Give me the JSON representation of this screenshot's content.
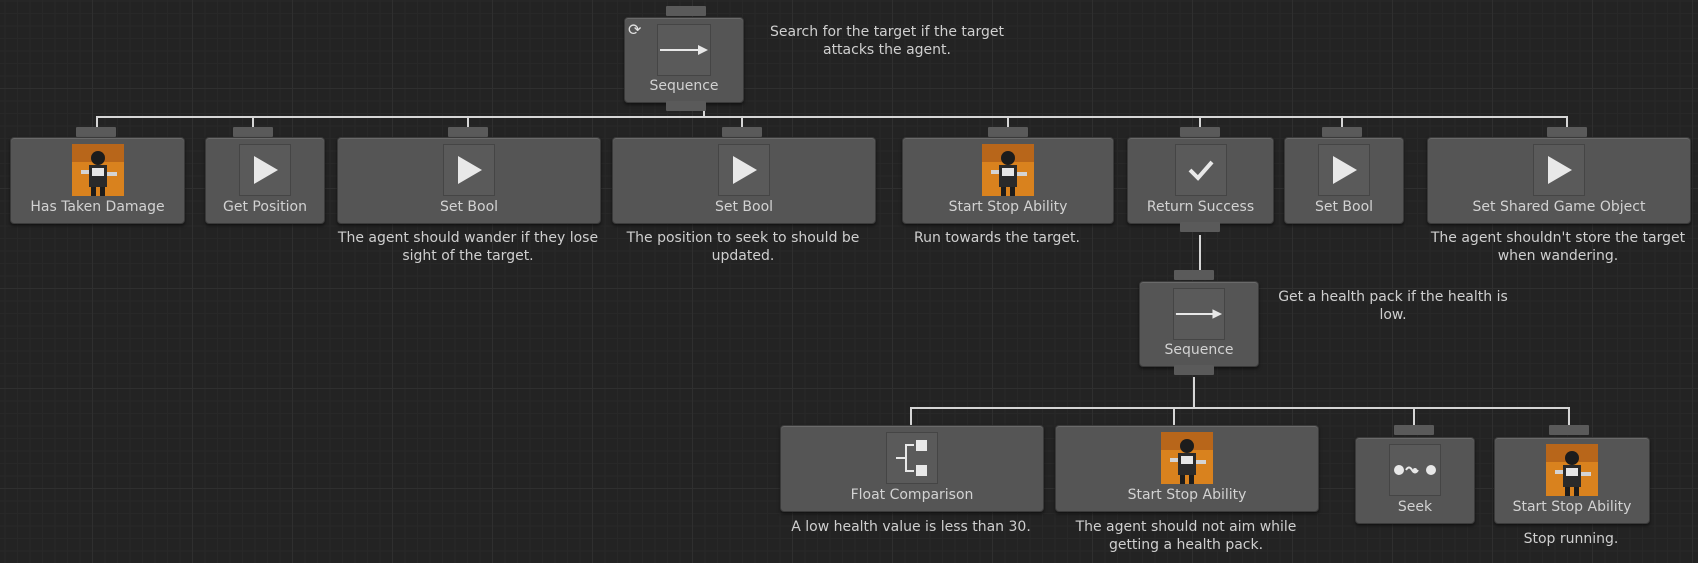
{
  "root": {
    "label": "Sequence",
    "comment": "Search for the target if the target attacks the agent.",
    "icon": "sequence-arrow-icon",
    "conditional_abort_icon": "restart-icon"
  },
  "level1": [
    {
      "label": "Has Taken Damage",
      "icon": "character-portrait-icon",
      "comment": ""
    },
    {
      "label": "Get Position",
      "icon": "play-icon",
      "comment": ""
    },
    {
      "label": "Set Bool",
      "icon": "play-icon",
      "comment": "The agent should wander if they lose sight of the target."
    },
    {
      "label": "Set Bool",
      "icon": "play-icon",
      "comment": "The position to seek to should be updated."
    },
    {
      "label": "Start Stop Ability",
      "icon": "character-portrait-icon",
      "comment": "Run towards the target."
    },
    {
      "label": "Return Success",
      "icon": "checkmark-icon",
      "comment": ""
    },
    {
      "label": "Set Bool",
      "icon": "play-icon",
      "comment": ""
    },
    {
      "label": "Set Shared Game Object",
      "icon": "play-icon",
      "comment": "The agent shouldn't store the target when wandering."
    }
  ],
  "sub_sequence": {
    "label": "Sequence",
    "comment": "Get a health pack if the health is low.",
    "icon": "sequence-arrow-icon"
  },
  "level3": [
    {
      "label": "Float Comparison",
      "icon": "branch-compare-icon",
      "comment": "A low health value is less than 30."
    },
    {
      "label": "Start Stop Ability",
      "icon": "character-portrait-icon",
      "comment": "The agent should not aim while getting a health pack."
    },
    {
      "label": "Seek",
      "icon": "path-dots-icon",
      "comment": ""
    },
    {
      "label": "Start Stop Ability",
      "icon": "character-portrait-icon",
      "comment": "Stop running."
    }
  ],
  "colors": {
    "background": "#232323",
    "node": "#555555",
    "wire": "#d6d6d6",
    "portrait_orange": "#d9821e"
  }
}
